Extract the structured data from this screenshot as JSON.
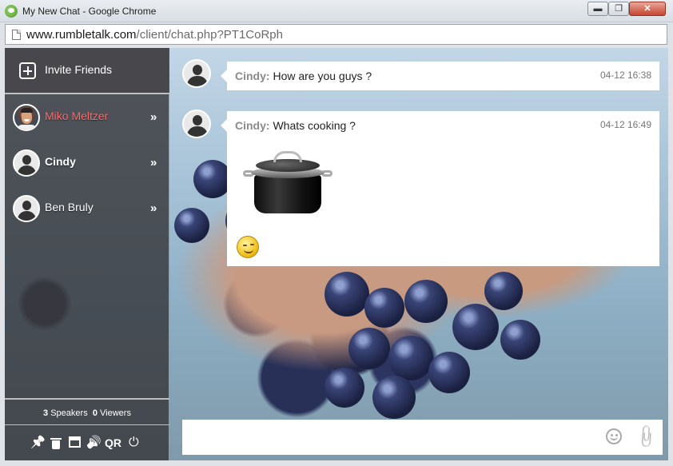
{
  "window": {
    "title": "My New Chat - Google Chrome",
    "min": "▬",
    "max": "❐",
    "close": "✕"
  },
  "address": {
    "domain": "www.rumbletalk.com",
    "path": "/client/chat.php?PT1CoRph"
  },
  "sidebar": {
    "invite_label": "Invite Friends",
    "users": [
      {
        "name": "Miko Meltzer",
        "status": "highlight"
      },
      {
        "name": "Cindy",
        "status": "bold"
      },
      {
        "name": "Ben Bruly",
        "status": "normal"
      }
    ],
    "chevron": "»",
    "speakers_count": "3",
    "speakers_label": "Speakers",
    "viewers_count": "0",
    "viewers_label": "Viewers",
    "toolbar": {
      "pin": "📌",
      "speaker": "🔊",
      "qr": "QR",
      "power": "⏻"
    }
  },
  "messages": [
    {
      "sender": "Cindy:",
      "text": "How are you guys ?",
      "time": "04-12 16:38"
    },
    {
      "sender": "Cindy:",
      "text": "Whats cooking ?",
      "time": "04-12 16:49",
      "image": "cooking-pot",
      "emoji": "wink"
    }
  ],
  "composer": {
    "value": "",
    "placeholder": "",
    "attach": "📎"
  },
  "colors": {
    "highlight_user": "#ff6a6a",
    "sidebar_bg": "#373737"
  }
}
